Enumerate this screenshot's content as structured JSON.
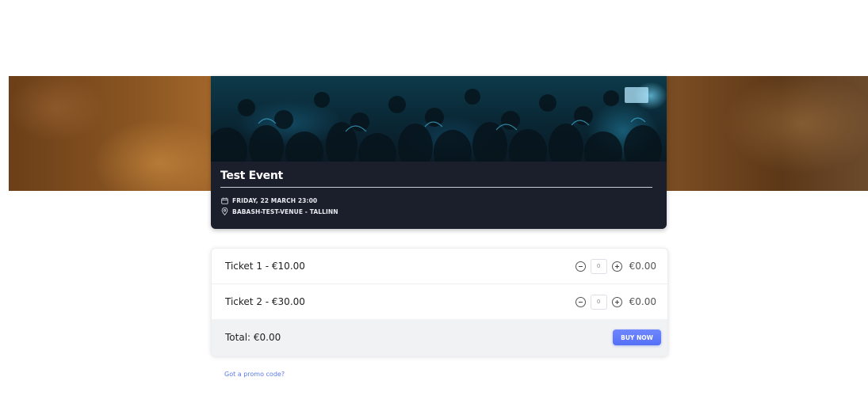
{
  "event": {
    "title": "Test Event",
    "date": "FRIDAY, 22 MARCH 23:00",
    "venue": "BABASH-TEST-VENUE - TALLINN"
  },
  "tickets": [
    {
      "name": "Ticket 1 - €10.00",
      "quantity": "0",
      "subtotal": "€0.00"
    },
    {
      "name": "Ticket 2 - €30.00",
      "quantity": "0",
      "subtotal": "€0.00"
    }
  ],
  "total": {
    "label": "Total: €0.00"
  },
  "buy_button": {
    "label": "BUY NOW"
  },
  "promo": {
    "label": "Got a promo code?"
  },
  "icons": {
    "calendar": "calendar-icon",
    "location": "map-pin-icon",
    "minus": "minus-circle-icon",
    "plus": "plus-circle-icon"
  },
  "colors": {
    "accent": "#5a78f5",
    "card_bg": "#1b1f2b",
    "link": "#5a78e8"
  }
}
